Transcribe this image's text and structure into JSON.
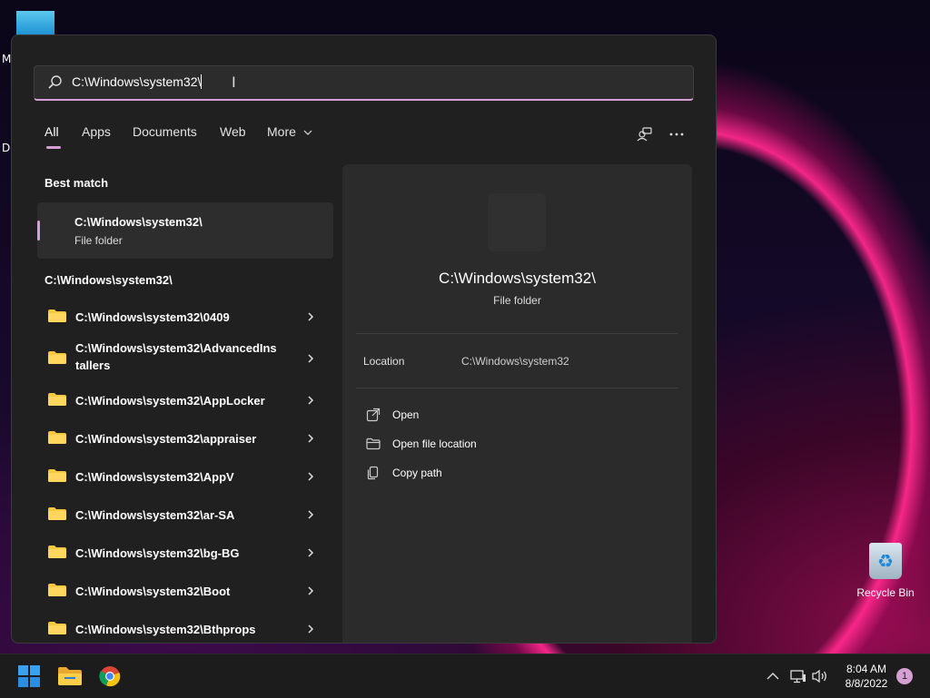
{
  "desktop": {
    "left_letters": [
      "M",
      "D"
    ],
    "recycle_bin_label": "Recycle Bin"
  },
  "search": {
    "query": "C:\\Windows\\system32\\"
  },
  "tabs": [
    {
      "label": "All",
      "active": true
    },
    {
      "label": "Apps"
    },
    {
      "label": "Documents"
    },
    {
      "label": "Web"
    },
    {
      "label": "More"
    }
  ],
  "best_match": {
    "heading": "Best match",
    "title": "C:\\Windows\\system32\\",
    "subtitle": "File folder"
  },
  "results": {
    "heading": "C:\\Windows\\system32\\",
    "items": [
      "C:\\Windows\\system32\\0409",
      "C:\\Windows\\system32\\AdvancedInstallers",
      "C:\\Windows\\system32\\AppLocker",
      "C:\\Windows\\system32\\appraiser",
      "C:\\Windows\\system32\\AppV",
      "C:\\Windows\\system32\\ar-SA",
      "C:\\Windows\\system32\\bg-BG",
      "C:\\Windows\\system32\\Boot",
      "C:\\Windows\\system32\\Bthprops"
    ]
  },
  "preview": {
    "title": "C:\\Windows\\system32\\",
    "subtitle": "File folder",
    "location_label": "Location",
    "location_value": "C:\\Windows\\system32",
    "actions": [
      "Open",
      "Open file location",
      "Copy path"
    ]
  },
  "taskbar": {
    "apps": [
      "start-icon",
      "file-explorer-icon",
      "chrome-icon"
    ],
    "time": "8:04 AM",
    "date": "8/8/2022",
    "notification_count": "1"
  },
  "colors": {
    "accent": "#d59fd4",
    "panel_bg": "#202020",
    "preview_bg": "#2b2b2b",
    "folder_yellow": "#f5c842"
  }
}
